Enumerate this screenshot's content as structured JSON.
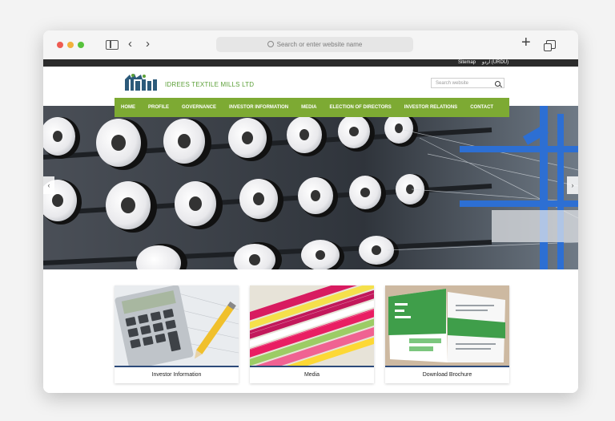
{
  "browser": {
    "address_placeholder": "Search or enter website name"
  },
  "topbar": {
    "sitemap": "Sitemap",
    "urdu": "اردو (URDU)"
  },
  "header": {
    "company_name": "IDREES TEXTILE MILLS LTD",
    "search_placeholder": "Search website"
  },
  "nav": {
    "items": [
      "HOME",
      "PROFILE",
      "GOVERNANCE",
      "INVESTOR INFORMATION",
      "MEDIA",
      "ELECTION OF DIRECTORS",
      "INVESTOR RELATIONS",
      "CONTACT"
    ]
  },
  "cards": [
    {
      "label": "Investor Information"
    },
    {
      "label": "Media"
    },
    {
      "label": "Download Brochure"
    }
  ],
  "colors": {
    "nav_green": "#7daa33",
    "brand_green": "#5b9f37",
    "logo_blue": "#2c5a7a",
    "card_bar": "#2c4a7a"
  }
}
